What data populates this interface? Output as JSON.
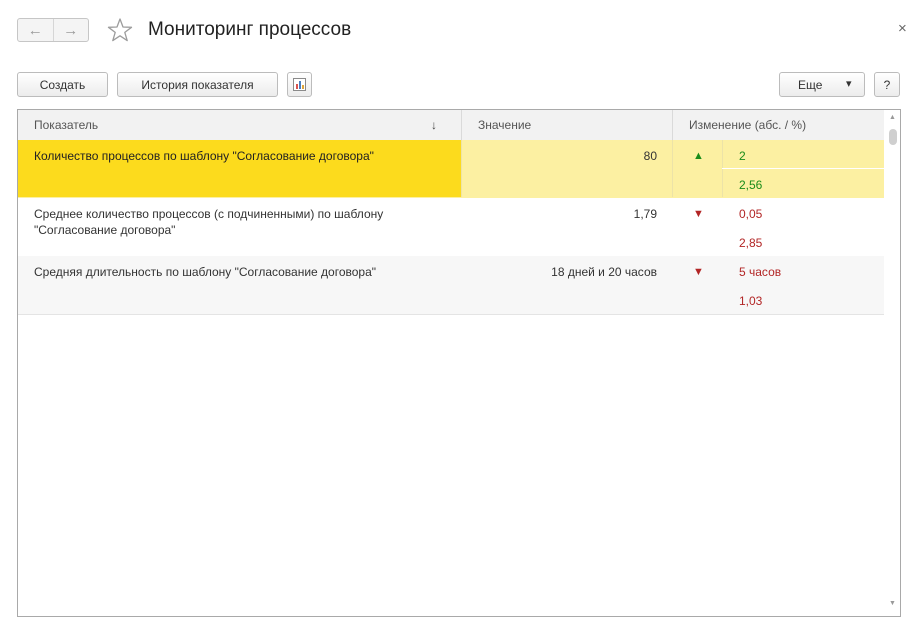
{
  "header": {
    "back_arrow": "←",
    "forward_arrow": "→",
    "star_icon": "star-outline",
    "title": "Мониторинг процессов",
    "close": "×"
  },
  "toolbar": {
    "create_label": "Создать",
    "history_label": "История показателя",
    "chart_icon": "bar-chart-icon",
    "more_label": "Еще",
    "more_arrow": "▾",
    "help_label": "?"
  },
  "table": {
    "columns": {
      "indicator": "Показатель",
      "sort_arrow": "↓",
      "value": "Значение",
      "change": "Изменение (абс. / %)"
    },
    "rows": [
      {
        "indicator": "Количество процессов по шаблону \"Согласование договора\"",
        "value": "80",
        "trend": "▲",
        "abs": "2",
        "pct": "2,56"
      },
      {
        "indicator": "Среднее количество процессов (с подчиненными) по шаблону \"Согласование договора\"",
        "value": "1,79",
        "trend": "▼",
        "abs": "0,05",
        "pct": "2,85"
      },
      {
        "indicator": "Средняя длительность по шаблону \"Согласование договора\"",
        "value": "18 дней и 20 часов",
        "trend": "▼",
        "abs": "5 часов",
        "pct": "1,03"
      }
    ]
  },
  "colors": {
    "selected_row_first_cell": "#fcdb1d",
    "selected_row": "#fcf0a2",
    "row_alt": "#f7f7f7",
    "up": "#1a8c1a",
    "down": "#b22525"
  }
}
